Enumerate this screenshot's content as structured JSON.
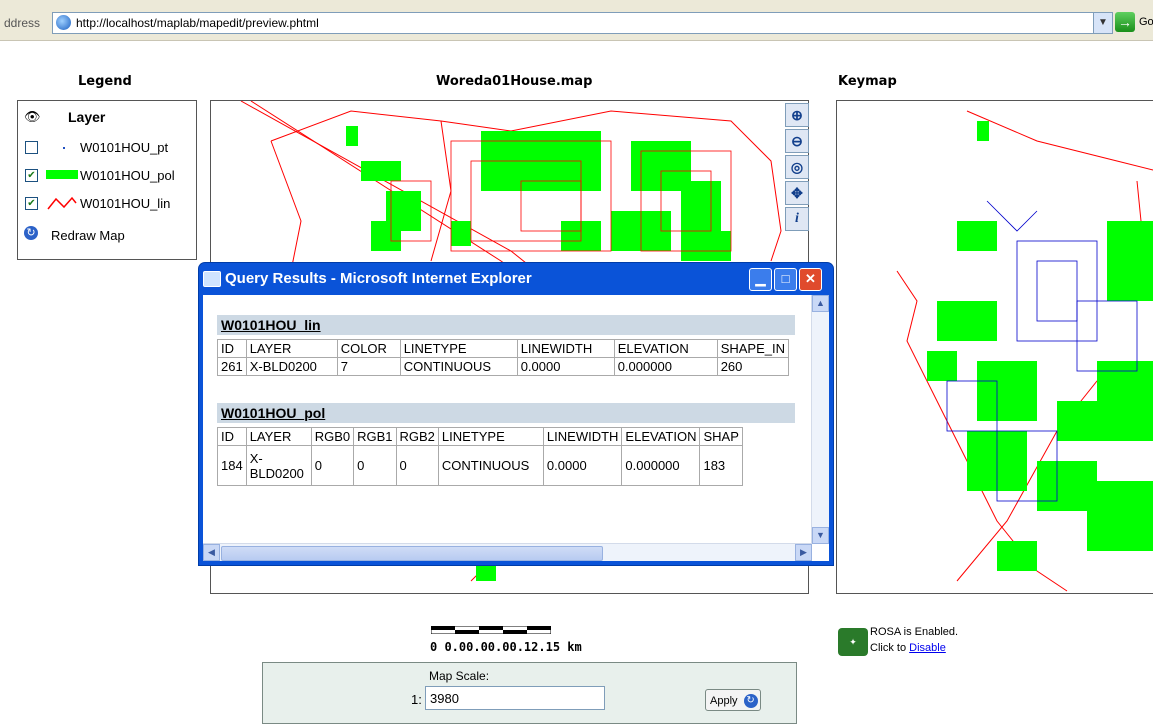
{
  "browser": {
    "address_label": "ddress",
    "url": "http://localhost/maplab/mapedit/preview.phtml",
    "go_label": "Go"
  },
  "headings": {
    "legend": "Legend",
    "map": "Woreda01House.map",
    "keymap": "Keymap"
  },
  "legend": {
    "column_header": "Layer",
    "layers": [
      {
        "label": "W0101HOU_pt",
        "checked": false,
        "symbol": "point"
      },
      {
        "label": "W0101HOU_pol",
        "checked": true,
        "symbol": "polygon-green"
      },
      {
        "label": "W0101HOU_lin",
        "checked": true,
        "symbol": "line-red"
      }
    ],
    "redraw_label": "Redraw Map"
  },
  "map_tools": [
    "zoom-in-icon",
    "zoom-out-icon",
    "zoom-extent-icon",
    "pan-icon",
    "info-icon"
  ],
  "popup": {
    "title": "Query Results - Microsoft Internet Explorer",
    "tables": [
      {
        "name": "W0101HOU_lin",
        "headers": [
          "ID",
          "LAYER",
          "COLOR",
          "LINETYPE",
          "LINEWIDTH",
          "ELEVATION",
          "SHAPE_IN"
        ],
        "rows": [
          [
            "261",
            "X-BLD0200",
            "7",
            "CONTINUOUS",
            "0.0000",
            "0.000000",
            "260"
          ]
        ]
      },
      {
        "name": "W0101HOU_pol",
        "headers": [
          "ID",
          "LAYER",
          "RGB0",
          "RGB1",
          "RGB2",
          "LINETYPE",
          "LINEWIDTH",
          "ELEVATION",
          "SHAP"
        ],
        "rows": [
          [
            "184",
            "X-BLD0200",
            "0",
            "0",
            "0",
            "CONTINUOUS",
            "0.0000",
            "0.000000",
            "183"
          ]
        ]
      }
    ]
  },
  "scale": {
    "bar_text": "0 0.00.00.00.12.15 km",
    "label": "Map Scale:",
    "prefix": "1:",
    "value": "3980",
    "apply_label": "Apply"
  },
  "rosa": {
    "status": "ROSA is Enabled.",
    "click_text": "Click to",
    "link": "Disable"
  },
  "colors": {
    "polygon": "#00ff00",
    "line": "#ff0000",
    "keymap_line": "#0000cc",
    "title_bar": "#0a53d8"
  }
}
